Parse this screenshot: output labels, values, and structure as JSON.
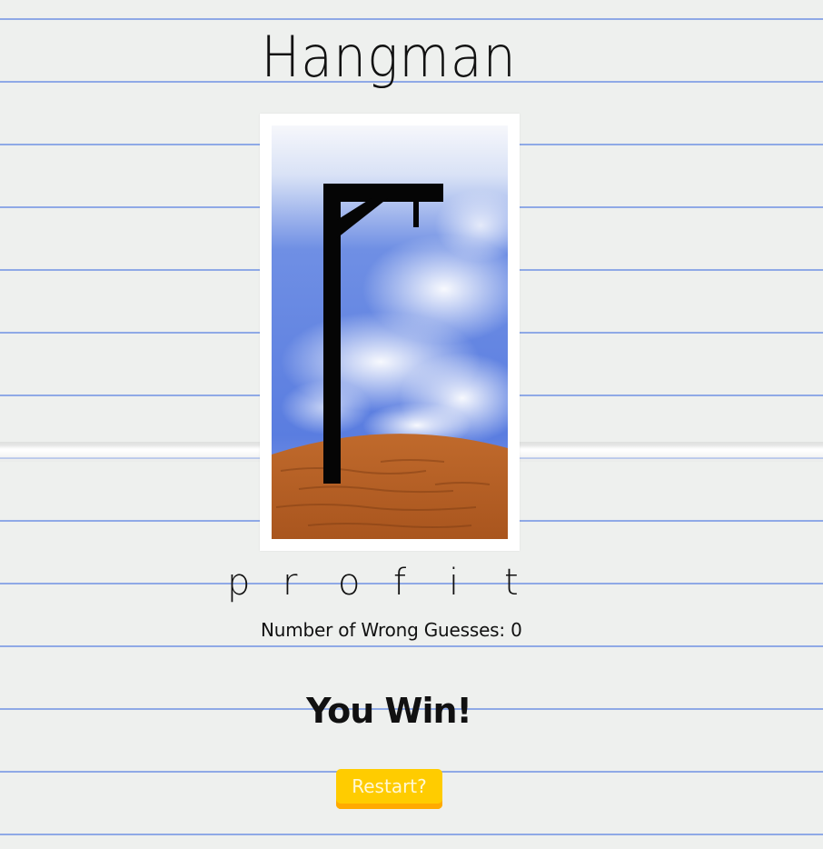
{
  "game": {
    "title": "Hangman",
    "word_letters": [
      "p",
      "r",
      "o",
      "f",
      "i",
      "t"
    ],
    "wrong_guesses_label": "Number of Wrong Guesses:",
    "wrong_guesses_count": "0",
    "result_message": "You Win!",
    "restart_label": "Restart?"
  },
  "colors": {
    "sky_top": "#f4f6fb",
    "sky_blue": "#5b7fe0",
    "ground": "#b8652a",
    "gallows": "#050505",
    "button": "#ffcc00",
    "button_shadow": "#ffaa00",
    "page_line": "#8fa9e6"
  },
  "icons": {
    "illustration": "gallows-illustration"
  }
}
